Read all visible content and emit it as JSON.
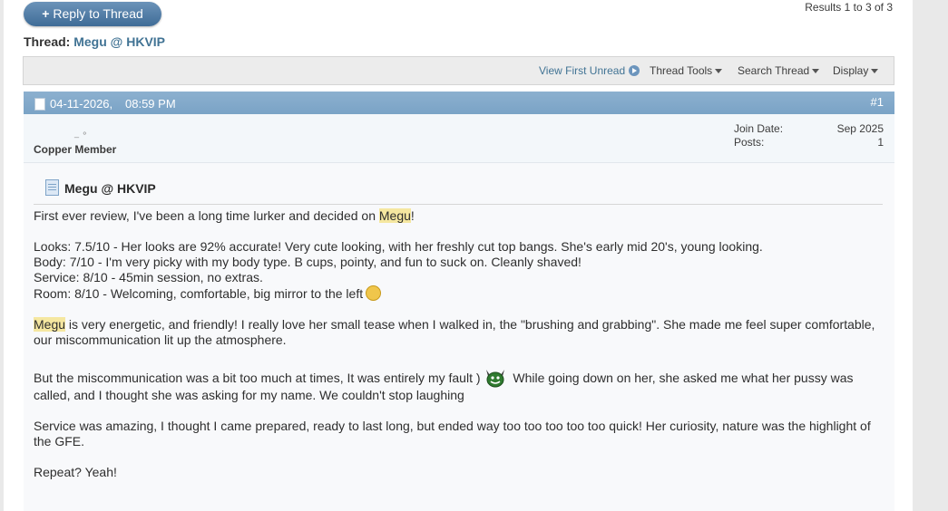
{
  "actions": {
    "reply_label": "Reply to Thread",
    "reply_plus": "+"
  },
  "results_text": "Results 1 to 3 of 3",
  "thread": {
    "prefix": "Thread:",
    "title": "Megu @ HKVIP"
  },
  "toolbar": {
    "view_first_unread": "View First Unread",
    "thread_tools": "Thread Tools",
    "search_thread": "Search Thread",
    "display": "Display"
  },
  "post": {
    "date": "04-11-2026,",
    "time": "08:59 PM",
    "number": "#1",
    "user_rank": "Copper Member",
    "join_date_label": "Join Date:",
    "join_date_value": "Sep 2025",
    "posts_label": "Posts:",
    "posts_value": "1",
    "title": "Megu @ HKVIP",
    "lines": {
      "l1_a": "First ever review, I've been a long time lurker and decided on ",
      "l1_hl": "Megu",
      "l1_b": "!",
      "looks": "Looks: 7.5/10 - Her looks are 92% accurate! Very cute looking, with her freshly cut top bangs. She's early mid 20's, young looking.",
      "body": "Body: 7/10 - I'm very picky with my body type. B cups, pointy, and fun to suck on. Cleanly shaved!",
      "service": "Service: 8/10 - 45min session, no extras.",
      "room": "Room: 8/10 - Welcoming, comfortable, big mirror to the left",
      "p3_hl": "Megu",
      "p3_rest": " is very energetic, and friendly! I really love her small tease when I walked in, the \"brushing and grabbing\". She made me feel super comfortable, our miscommunication lit up the atmosphere.",
      "p4_a": "But the miscommunication was a bit too much at times, It was entirely my fault )",
      "p4_b": " While going down on her, she asked me what her pussy was called, and I thought she was asking for my name. We couldn't stop laughing",
      "p5": "Service was amazing, I thought I came prepared, ready to last long, but ended way too too too too too quick! Her curiosity, nature was the highlight of the GFE.",
      "p6": "Repeat? Yeah!"
    }
  },
  "icons": {
    "plus": "plus-icon",
    "go": "arrow-circle-icon",
    "caret": "caret-down-icon",
    "doc": "document-icon",
    "smiley": "grin-smiley-icon",
    "devil": "devil-smiley-icon"
  },
  "colors": {
    "accent": "#417394",
    "header_bar": "#82a9ca",
    "highlight": "#f5e7a0"
  }
}
